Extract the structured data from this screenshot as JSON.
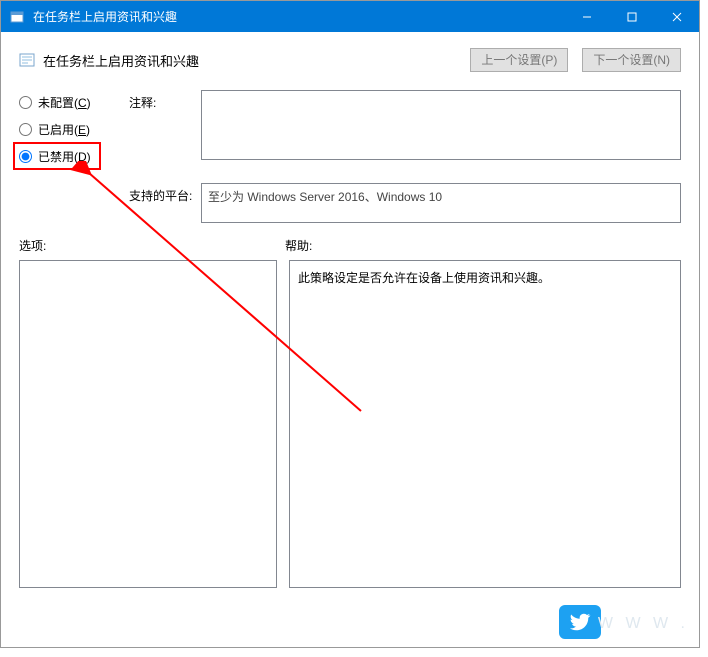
{
  "titlebar": {
    "title": "在任务栏上启用资讯和兴趣"
  },
  "header": {
    "title": "在任务栏上启用资讯和兴趣",
    "prev_btn": "上一个设置(P)",
    "next_btn": "下一个设置(N)"
  },
  "radio": {
    "not_configured": "未配置(C)",
    "enabled": "已启用(E)",
    "disabled": "已禁用(D)",
    "selected": "disabled"
  },
  "labels": {
    "comment": "注释:",
    "platform": "支持的平台:",
    "options": "选项:",
    "help": "帮助:"
  },
  "comment_value": "",
  "platform_value": "至少为 Windows Server 2016、Windows 10",
  "help_text": "此策略设定是否允许在设备上使用资讯和兴趣。",
  "watermark": "W W W ."
}
